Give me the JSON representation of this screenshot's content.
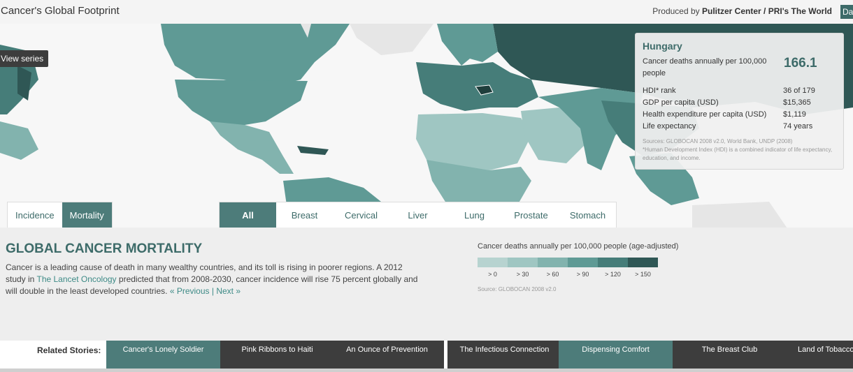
{
  "header": {
    "title": "Cancer's Global Footprint",
    "produced_prefix": "Produced by",
    "producer": "Pulitzer Center / PRI's The World",
    "corner_button": "Da"
  },
  "map": {
    "view_series_label": "View series"
  },
  "info_panel": {
    "country": "Hungary",
    "main_label": "Cancer deaths annually per 100,000 people",
    "main_value": "166.1",
    "stats": [
      {
        "label": "HDI* rank",
        "value": "36 of 179"
      },
      {
        "label": "GDP per capita (USD)",
        "value": "$15,365"
      },
      {
        "label": "Health expenditure per capita (USD)",
        "value": "$1,119"
      },
      {
        "label": "Life expectancy",
        "value": "74 years"
      }
    ],
    "sources": "Sources: GLOBOCAN 2008 v2.0, World Bank, UNDP (2008)",
    "footnote": "*Human Development Index (HDI) is a combined indicator of life expectancy, education, and income."
  },
  "type_tabs": [
    {
      "label": "Incidence",
      "active": false
    },
    {
      "label": "Mortality",
      "active": true
    }
  ],
  "cancer_tabs": [
    {
      "label": "All",
      "active": true
    },
    {
      "label": "Breast",
      "active": false
    },
    {
      "label": "Cervical",
      "active": false
    },
    {
      "label": "Liver",
      "active": false
    },
    {
      "label": "Lung",
      "active": false
    },
    {
      "label": "Prostate",
      "active": false
    },
    {
      "label": "Stomach",
      "active": false
    }
  ],
  "section": {
    "title": "GLOBAL CANCER MORTALITY",
    "body_before_link": "Cancer is a leading cause of death in many wealthy countries, and its toll is rising in poorer regions. A 2012 study in ",
    "link": "The Lancet Oncology",
    "body_after_link": " predicted that from 2008-2030, cancer incidence will rise 75 percent globally and will double in the least developed countries. ",
    "prev": "« Previous",
    "sep": " | ",
    "next": "Next »"
  },
  "legend": {
    "title": "Cancer deaths annually per 100,000 people (age-adjusted)",
    "buckets": [
      {
        "label": "> 0",
        "color": "#b7d3d0"
      },
      {
        "label": "> 30",
        "color": "#9fc6c2"
      },
      {
        "label": "> 60",
        "color": "#82b3ae"
      },
      {
        "label": "> 90",
        "color": "#5f9a95"
      },
      {
        "label": "> 120",
        "color": "#467d79"
      },
      {
        "label": "> 150",
        "color": "#2f5755"
      }
    ],
    "source": "Source: GLOBOCAN 2008 v2.0"
  },
  "related": {
    "label": "Related Stories:",
    "stories": [
      {
        "title": "Cancer's Lonely Soldier",
        "highlight": true
      },
      {
        "title": "Pink Ribbons to Haiti",
        "highlight": false
      },
      {
        "title": "An Ounce of Prevention",
        "highlight": false
      },
      {
        "title": "The Infectious Connection",
        "highlight": false
      },
      {
        "title": "Dispensing Comfort",
        "highlight": true
      },
      {
        "title": "The Breast Club",
        "highlight": false
      },
      {
        "title": "Land of Tobacco",
        "highlight": false
      }
    ]
  },
  "colors": {
    "accent": "#4d7c7a",
    "dark_story": "#3d3d3d"
  }
}
